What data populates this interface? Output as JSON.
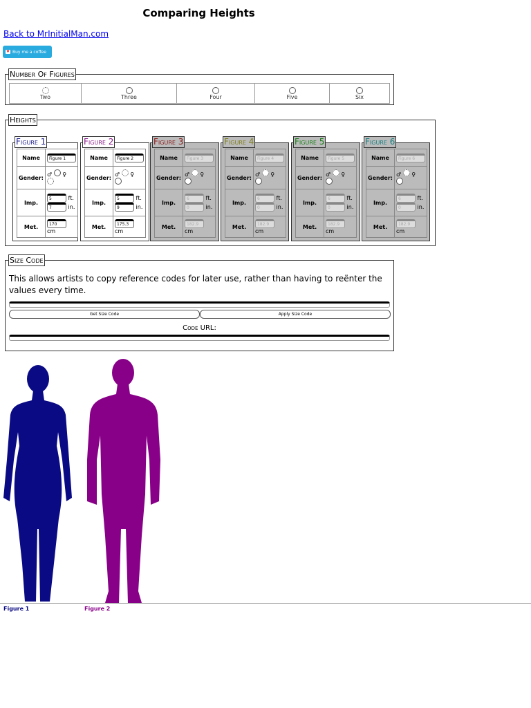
{
  "page_title": "Comparing Heights",
  "back_link": "Back to MrInitialMan.com",
  "coffee_button": "Buy me a coffee",
  "number_of_figures": {
    "legend": "Number Of Figures",
    "options": [
      "Two",
      "Three",
      "Four",
      "Five",
      "Six"
    ],
    "selected": "Two"
  },
  "heights": {
    "legend": "Heights",
    "labels": {
      "name": "Name",
      "gender": "Gender:",
      "imp": "Imp.",
      "met": "Met.",
      "ft": "ft.",
      "in": "in.",
      "cm": "cm",
      "male": "♂",
      "female": "♀"
    },
    "figures": [
      {
        "title": "Figure 1",
        "color": "#1a1a8c",
        "name": "Figure 1",
        "ft": "5",
        "in": "7",
        "cm": "170",
        "enabled": true,
        "gender": "female"
      },
      {
        "title": "Figure 2",
        "color": "#8a1a8a",
        "name": "Figure 2",
        "ft": "5",
        "in": "9",
        "cm": "175.3",
        "enabled": true,
        "gender": "male"
      },
      {
        "title": "Figure 3",
        "color": "#8b1a1a",
        "name": "Figure 3",
        "ft": "6",
        "in": "0",
        "cm": "182.9",
        "enabled": false
      },
      {
        "title": "Figure 4",
        "color": "#808020",
        "name": "Figure 4",
        "ft": "6",
        "in": "0",
        "cm": "182.9",
        "enabled": false
      },
      {
        "title": "Figure 5",
        "color": "#1a801a",
        "name": "Figure 5",
        "ft": "6",
        "in": "0",
        "cm": "182.9",
        "enabled": false
      },
      {
        "title": "Figure 6",
        "color": "#1a8080",
        "name": "Figure 6",
        "ft": "6",
        "in": "0",
        "cm": "182.9",
        "enabled": false
      }
    ]
  },
  "size_code": {
    "legend": "Size Code",
    "description": "This allows artists to copy reference codes for later use, rather than having to reënter the values every time.",
    "code_value": "",
    "get_button": "Get Size Code",
    "apply_button": "Apply Size Code",
    "code_url_label": "Code URL:",
    "code_url_value": ""
  },
  "display": {
    "figures": [
      {
        "label": "Figure 1",
        "color": "#0a0a84",
        "height_cm": 170
      },
      {
        "label": "Figure 2",
        "color": "#880088",
        "height_cm": 175.3
      }
    ]
  }
}
